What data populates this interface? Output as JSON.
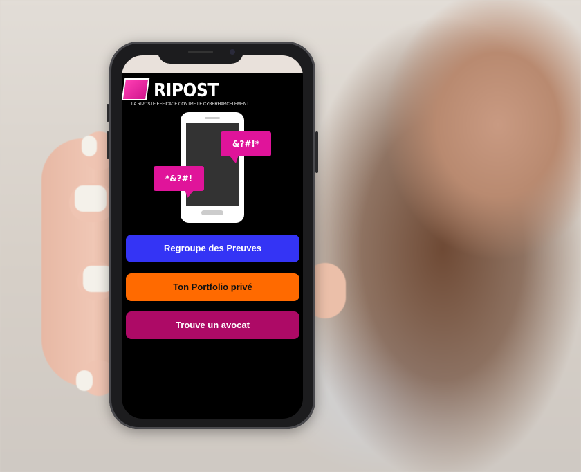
{
  "app": {
    "name": "RIPOST",
    "tagline": "LA RIPOSTE EFFICACE CONTRE LE CYBERHARCELEMENT"
  },
  "illustration": {
    "bubble_right": "&?#!*",
    "bubble_left": "*&?#!"
  },
  "buttons": {
    "evidence": "Regroupe des Preuves",
    "portfolio": "Ton Portfolio privé",
    "lawyer": "Trouve un avocat"
  },
  "colors": {
    "evidence_button": "#3434f5",
    "portfolio_button": "#ff6a00",
    "lawyer_button": "#ad0a66",
    "bubble": "#e0149a",
    "screen_background": "#000000"
  }
}
